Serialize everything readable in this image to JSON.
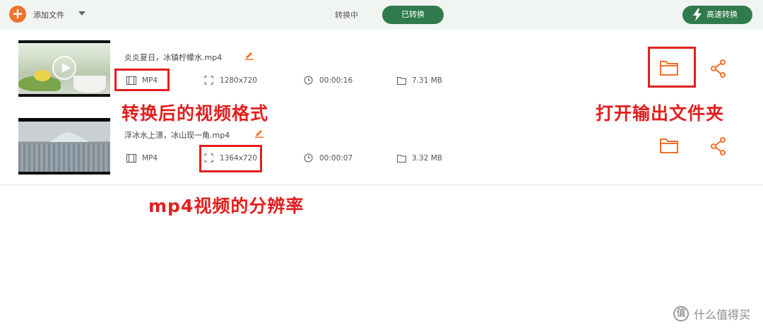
{
  "toolbar": {
    "add_label": "添加文件",
    "tab_converting": "转换中",
    "tab_converted": "已转换",
    "fast_label": "高速转换"
  },
  "files": [
    {
      "name": "炎炎夏日，冰镇柠檬水.mp4",
      "format": "MP4",
      "resolution": "1280x720",
      "duration": "00:00:16",
      "size": "7.31 MB"
    },
    {
      "name": "浮冰水上漂，冰山现一角.mp4",
      "format": "MP4",
      "resolution": "1364x720",
      "duration": "00:00:07",
      "size": "3.32 MB"
    }
  ],
  "annotations": {
    "format_note": "转换后的视频格式",
    "folder_note": "打开输出文件夹",
    "resolution_note": "mp4视频的分辨率"
  },
  "watermark": "什么值得买",
  "colors": {
    "accent_green": "#2f7b4d",
    "accent_orange": "#f0722c",
    "annotation_red": "#e0201f"
  }
}
